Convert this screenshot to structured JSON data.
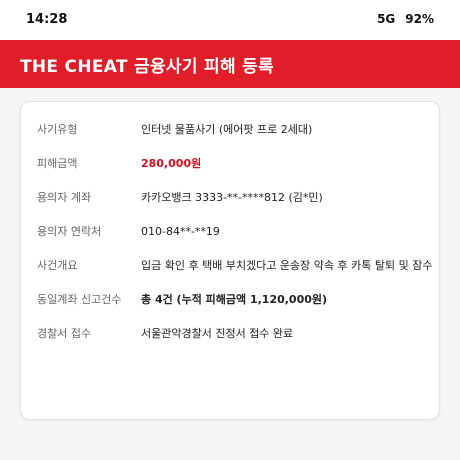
{
  "status_bar": {
    "time": "14:28",
    "network": "5G",
    "battery": "92%"
  },
  "header": {
    "title": "THE CHEAT 금융사기 피해 등록"
  },
  "details": [
    {
      "label": "사기유형",
      "value": "인터넷 물품사기 (에어팟 프로 2세대)"
    },
    {
      "label": "피해금액",
      "value": "280,000원"
    },
    {
      "label": "용의자 계좌",
      "value": "카카오뱅크 3333-**-****812 (김*민)"
    },
    {
      "label": "용의자 연락처",
      "value": "010-84**-**19"
    },
    {
      "label": "사건개요",
      "value": "입금 확인 후 택배 부치겠다고 운송장 약속 후 카톡 탈퇴 및 잠수"
    },
    {
      "label": "동일계좌 신고건수",
      "value": "총 4건 (누적 피해금액 1,120,000원)"
    },
    {
      "label": "경찰서 접수",
      "value": "서울관악경찰서 진정서 접수 완료"
    }
  ],
  "colors": {
    "accent": "#e11d2a",
    "amount": "#d0101e"
  }
}
